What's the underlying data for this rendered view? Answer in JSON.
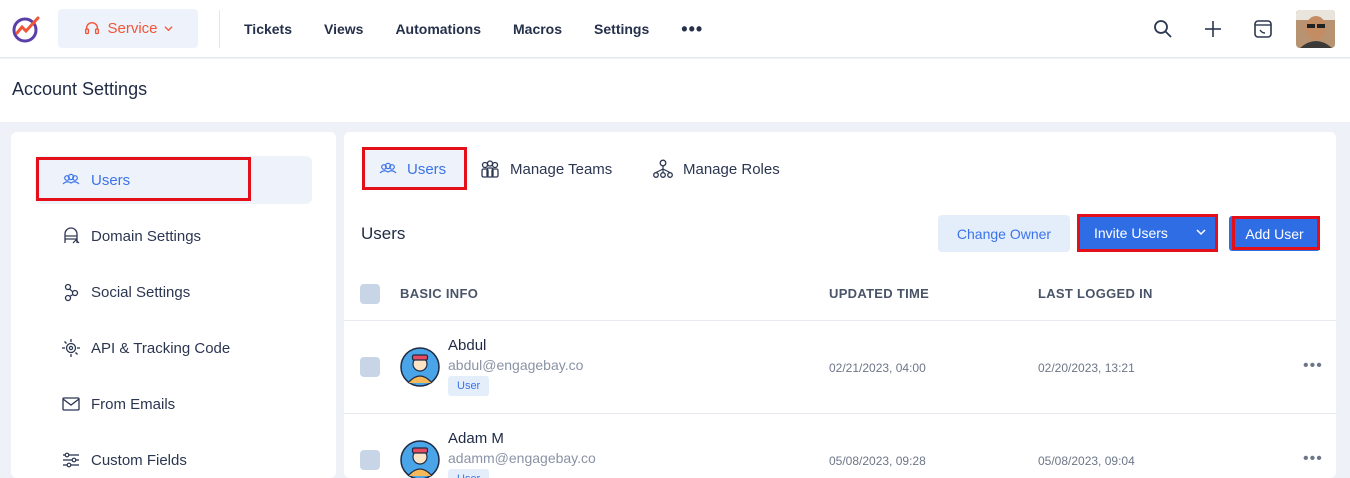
{
  "topbar": {
    "service_label": "Service",
    "nav": [
      "Tickets",
      "Views",
      "Automations",
      "Macros",
      "Settings"
    ],
    "more_label": "•••",
    "icons": [
      "search-icon",
      "plus-icon",
      "widget-icon",
      "user-avatar"
    ]
  },
  "page": {
    "title": "Account Settings"
  },
  "sidebar": {
    "items": [
      {
        "label": "Users",
        "icon": "users-icon"
      },
      {
        "label": "Domain Settings",
        "icon": "domain-icon"
      },
      {
        "label": "Social Settings",
        "icon": "share-icon"
      },
      {
        "label": "API & Tracking Code",
        "icon": "api-icon"
      },
      {
        "label": "From Emails",
        "icon": "mail-icon"
      },
      {
        "label": "Custom Fields",
        "icon": "sliders-icon"
      }
    ]
  },
  "tabs": [
    {
      "label": "Users"
    },
    {
      "label": "Manage Teams"
    },
    {
      "label": "Manage Roles"
    }
  ],
  "users_section": {
    "title": "Users",
    "change_owner_label": "Change Owner",
    "invite_users_label": "Invite Users",
    "add_user_label": "Add User",
    "columns": [
      "BASIC INFO",
      "UPDATED TIME",
      "LAST LOGGED IN"
    ],
    "rows": [
      {
        "name": "Abdul",
        "email": "abdul@engagebay.co",
        "role": "User",
        "updated": "02/21/2023, 04:00",
        "last_login": "02/20/2023, 13:21"
      },
      {
        "name": "Adam M",
        "email": "adamm@engagebay.co",
        "role": "User",
        "updated": "05/08/2023, 09:28",
        "last_login": "05/08/2023, 09:04"
      }
    ],
    "row_more_label": "•••"
  },
  "colors": {
    "accent": "#3b73e8",
    "primary_button": "#2f6de5",
    "service": "#f0553a",
    "highlight": "#e3101a"
  }
}
